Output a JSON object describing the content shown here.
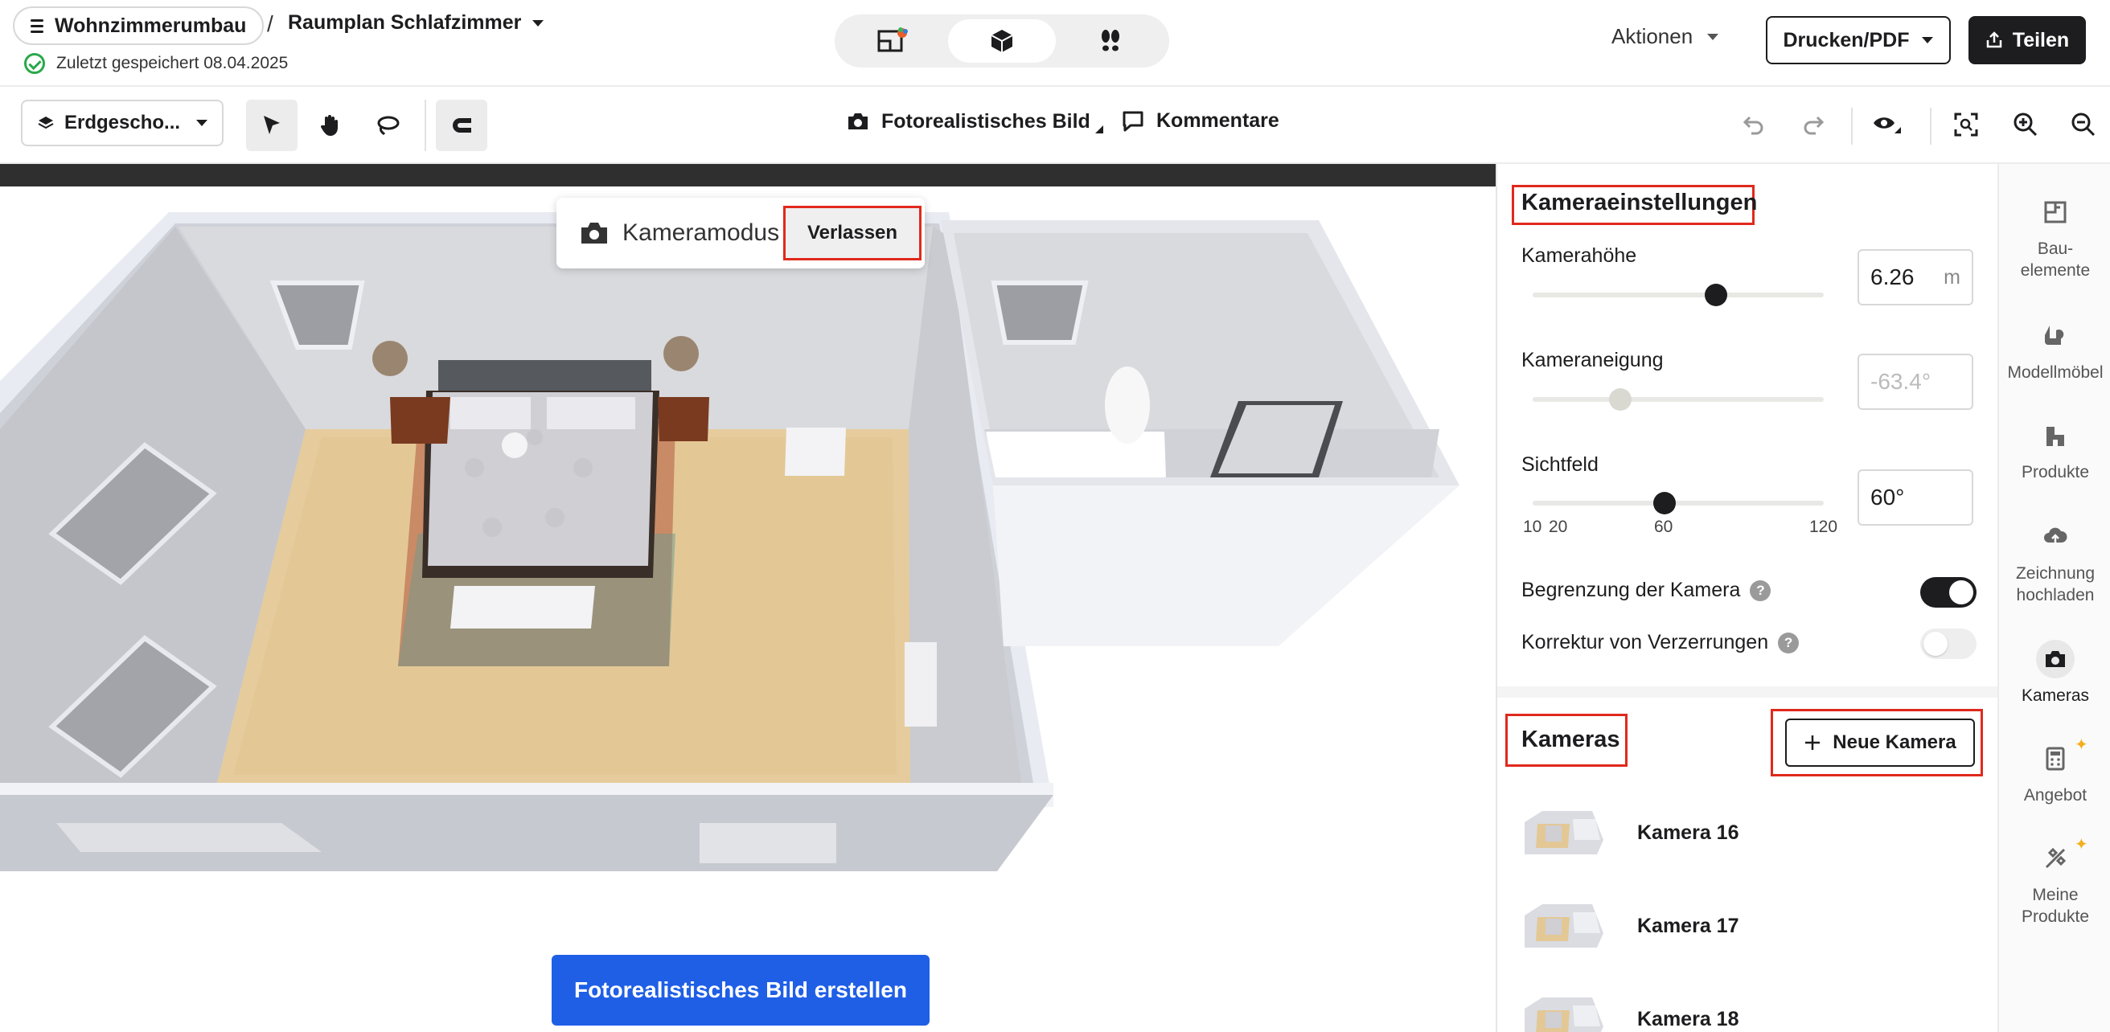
{
  "header": {
    "project_name": "Wohnzimmerumbau",
    "breadcrumb_sep": "/",
    "plan_name": "Raumplan Schlafzimmer",
    "saved_status": "Zuletzt gespeichert 08.04.2025",
    "actions_label": "Aktionen",
    "print_label": "Drucken/PDF",
    "share_label": "Teilen"
  },
  "toolbar": {
    "floor_label": "Erdgescho...",
    "photo_tab": "Fotorealistisches Bild",
    "comments_tab": "Kommentare"
  },
  "canvas": {
    "camera_mode_label": "Kameramodus",
    "exit_label": "Verlassen",
    "render_button": "Fotorealistisches Bild erstellen"
  },
  "camera_settings": {
    "title": "Kameraeinstellungen",
    "height_label": "Kamerahöhe",
    "height_value": "6.26",
    "height_unit": "m",
    "height_level": 0.63,
    "tilt_label": "Kameraneigung",
    "tilt_value": "-63.4°",
    "tilt_level": 0.3,
    "fov_label": "Sichtfeld",
    "fov_value": "60°",
    "fov_ticks": [
      "10",
      "20",
      "60",
      "120"
    ],
    "limit_label": "Begrenzung der Kamera",
    "limit_on": true,
    "distortion_label": "Korrektur von Verzerrungen",
    "distortion_on": false
  },
  "cameras": {
    "title": "Kameras",
    "new_button": "Neue Kamera",
    "items": [
      {
        "label": "Kamera 16"
      },
      {
        "label": "Kamera 17"
      },
      {
        "label": "Kamera 18"
      }
    ]
  },
  "rail": {
    "items": [
      {
        "label_1": "Bau-",
        "label_2": "elemente",
        "icon": "building-elements-icon"
      },
      {
        "label_1": "Modellmöbel",
        "label_2": "",
        "icon": "model-furniture-icon"
      },
      {
        "label_1": "Produkte",
        "label_2": "",
        "icon": "products-icon"
      },
      {
        "label_1": "Zeichnung",
        "label_2": "hochladen",
        "icon": "upload-cloud-icon"
      },
      {
        "label_1": "Kameras",
        "label_2": "",
        "icon": "camera-icon"
      },
      {
        "label_1": "Angebot",
        "label_2": "",
        "icon": "calculator-icon"
      },
      {
        "label_1": "Meine",
        "label_2": "Produkte",
        "icon": "my-products-icon"
      }
    ]
  },
  "colors": {
    "accent_blue": "#1f5fe6",
    "highlight_red": "#e0291c",
    "dark": "#1d1d1f"
  }
}
